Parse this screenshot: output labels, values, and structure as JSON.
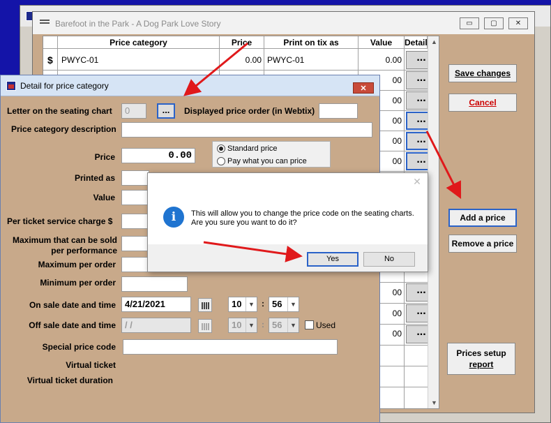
{
  "back_window": {
    "title": "Barefoot in the Park - A Dog Park Love Story",
    "columns": [
      "Price category",
      "Price",
      "Print on tix as",
      "Value",
      "Details"
    ],
    "first_row": {
      "marker": "$",
      "category": "PWYC-01",
      "price": "0.00",
      "print_as": "PWYC-01",
      "value": "0.00"
    },
    "value_column": [
      "00",
      "00",
      "00",
      "00",
      "00",
      "00",
      "00",
      "00",
      "00",
      "00",
      "00",
      "00"
    ],
    "details_button_label": "...",
    "buttons": {
      "save": "Save changes",
      "cancel": "Cancel",
      "add": "Add a price",
      "remove": "Remove a price",
      "setup_line1": "Prices setup",
      "setup_line2": "report"
    },
    "window_controls": {
      "minimize": "▭",
      "maximize": "▢",
      "close": "✕"
    }
  },
  "detail_window": {
    "title": "Detail for price category",
    "close": "✕",
    "letter_label": "Letter on the seating chart",
    "letter_value": "0",
    "letter_button": "...",
    "display_order_label": "Displayed price order (in Webtix)",
    "display_order_value": "",
    "description_label": "Price category description",
    "description_value": "",
    "price_label": "Price",
    "price_value": "0.00",
    "price_type_options": [
      "Standard price",
      "Pay what you can price"
    ],
    "price_type_selected": "Standard price",
    "printed_as_label": "Printed as",
    "value_label": "Value",
    "service_charge_label": "Per ticket service charge  $",
    "max_sold_label_1": "Maximum that can be sold",
    "max_sold_label_2": "per performance",
    "max_order_label": "Maximum per order",
    "min_order_label": "Minimum per order",
    "onsale_label": "On sale date and time",
    "onsale_date": "4/21/2021",
    "onsale_hour": "10",
    "onsale_minute": "56",
    "offsale_label": "Off sale date and time",
    "offsale_date": " /  /",
    "offsale_hour": "10",
    "offsale_minute": "56",
    "used_label": "Used",
    "special_code_label": "Special price code",
    "virtual_ticket_label": "Virtual ticket",
    "virtual_duration_label": "Virtual ticket duration",
    "time_separator": ":"
  },
  "dialog": {
    "icon": "i",
    "message": "This will allow you to change the price code on the seating charts. Are you sure you want to do it?",
    "yes": "Yes",
    "no": "No",
    "close": "✕"
  },
  "annotation_color": "#e0191b"
}
